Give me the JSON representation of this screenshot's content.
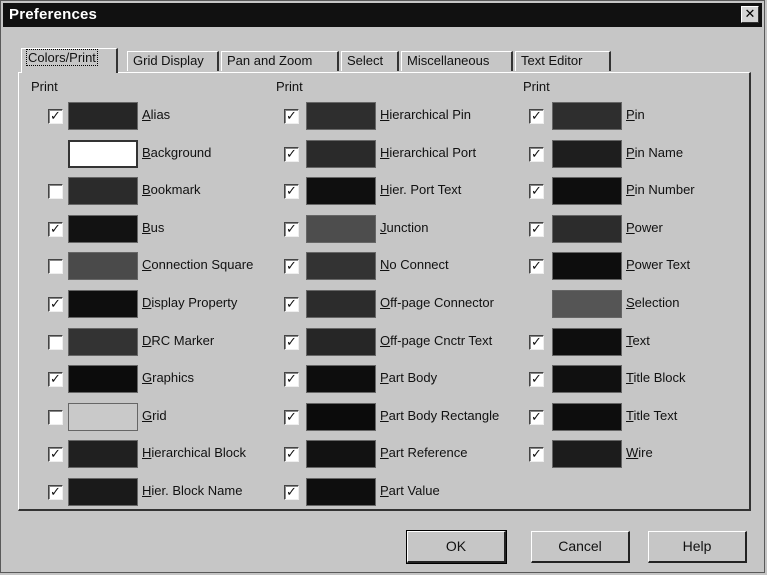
{
  "window": {
    "title": "Preferences",
    "close_glyph": "✕"
  },
  "tabs": [
    "Colors/Print",
    "Grid Display",
    "Pan and Zoom",
    "Select",
    "Miscellaneous",
    "Text Editor"
  ],
  "active_tab": 0,
  "print_header": "Print",
  "check_glyph": "✓",
  "columns": [
    [
      {
        "label": "Alias",
        "checked": true,
        "color": "#262626"
      },
      {
        "label": "Background",
        "checked": null,
        "color": "#ffffff"
      },
      {
        "label": "Bookmark",
        "checked": false,
        "color": "#2b2b2b"
      },
      {
        "label": "Bus",
        "checked": true,
        "color": "#121212"
      },
      {
        "label": "Connection Square",
        "checked": false,
        "color": "#4a4a4a"
      },
      {
        "label": "Display Property",
        "checked": true,
        "color": "#0e0e0e"
      },
      {
        "label": "DRC Marker",
        "checked": false,
        "color": "#333333"
      },
      {
        "label": "Graphics",
        "checked": true,
        "color": "#0c0c0c"
      },
      {
        "label": "Grid",
        "checked": false,
        "color": "#c9c9c9"
      },
      {
        "label": "Hierarchical Block",
        "checked": true,
        "color": "#202020"
      },
      {
        "label": "Hier. Block Name",
        "checked": true,
        "color": "#1a1a1a"
      }
    ],
    [
      {
        "label": "Hierarchical Pin",
        "checked": true,
        "color": "#2e2e2e"
      },
      {
        "label": "Hierarchical Port",
        "checked": true,
        "color": "#2a2a2a"
      },
      {
        "label": "Hier. Port Text",
        "checked": true,
        "color": "#0f0f0f"
      },
      {
        "label": "Junction",
        "checked": true,
        "color": "#4d4d4d"
      },
      {
        "label": "No Connect",
        "checked": true,
        "color": "#333333"
      },
      {
        "label": "Off-page Connector",
        "checked": true,
        "color": "#2c2c2c"
      },
      {
        "label": "Off-page Cnctr Text",
        "checked": true,
        "color": "#262626"
      },
      {
        "label": "Part Body",
        "checked": true,
        "color": "#0d0d0d"
      },
      {
        "label": "Part Body Rectangle",
        "checked": true,
        "color": "#0b0b0b"
      },
      {
        "label": "Part Reference",
        "checked": true,
        "color": "#121212"
      },
      {
        "label": "Part Value",
        "checked": true,
        "color": "#0e0e0e"
      }
    ],
    [
      {
        "label": "Pin",
        "checked": true,
        "color": "#2e2e2e"
      },
      {
        "label": "Pin Name",
        "checked": true,
        "color": "#1e1e1e"
      },
      {
        "label": "Pin Number",
        "checked": true,
        "color": "#0e0e0e"
      },
      {
        "label": "Power",
        "checked": true,
        "color": "#2c2c2c"
      },
      {
        "label": "Power Text",
        "checked": true,
        "color": "#0d0d0d"
      },
      {
        "label": "Selection",
        "checked": null,
        "color": "#555555"
      },
      {
        "label": "Text",
        "checked": true,
        "color": "#0e0e0e"
      },
      {
        "label": "Title Block",
        "checked": true,
        "color": "#101010"
      },
      {
        "label": "Title Text",
        "checked": true,
        "color": "#0d0d0d"
      },
      {
        "label": "Wire",
        "checked": true,
        "color": "#1c1c1c"
      }
    ]
  ],
  "buttons": {
    "ok": "OK",
    "cancel": "Cancel",
    "help": "Help"
  }
}
